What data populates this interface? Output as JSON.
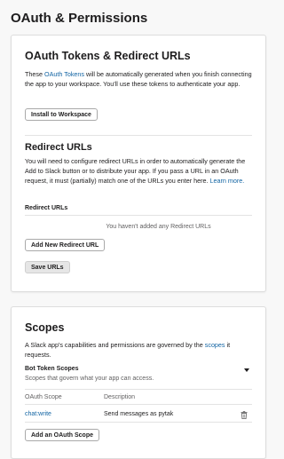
{
  "page": {
    "title": "OAuth & Permissions"
  },
  "tokens": {
    "title": "OAuth Tokens & Redirect URLs",
    "desc_before": "These ",
    "desc_link": "OAuth Tokens",
    "desc_after": " will be automatically generated when you finish connecting the app to your workspace. You'll use these tokens to authenticate your app.",
    "install_button": "Install to Workspace"
  },
  "redirect": {
    "title": "Redirect URLs",
    "desc": "You will need to configure redirect URLs in order to automatically generate the Add to Slack button or to distribute your app. If you pass a URL in an OAuth request, it must (partially) match one of the URLs you enter here.",
    "learn_more": "Learn more.",
    "list_header": "Redirect URLs",
    "empty_text": "You haven't added any Redirect URLs",
    "add_button": "Add New Redirect URL",
    "save_button": "Save URLs"
  },
  "scopes": {
    "title": "Scopes",
    "desc_before": "A Slack app's capabilities and permissions are governed by the ",
    "desc_link": "scopes",
    "desc_after": " it requests.",
    "bot_section_title": "Bot Token Scopes",
    "bot_section_desc": "Scopes that govern what your app can access.",
    "col_scope": "OAuth Scope",
    "col_description": "Description",
    "rows": [
      {
        "scope": "chat:write",
        "description": "Send messages as pytak",
        "action_icon": "trash-icon"
      }
    ],
    "add_button": "Add an OAuth Scope"
  },
  "colors": {
    "link": "#1264a3",
    "text": "#1d1c1d",
    "background": "#f8f8f8"
  }
}
